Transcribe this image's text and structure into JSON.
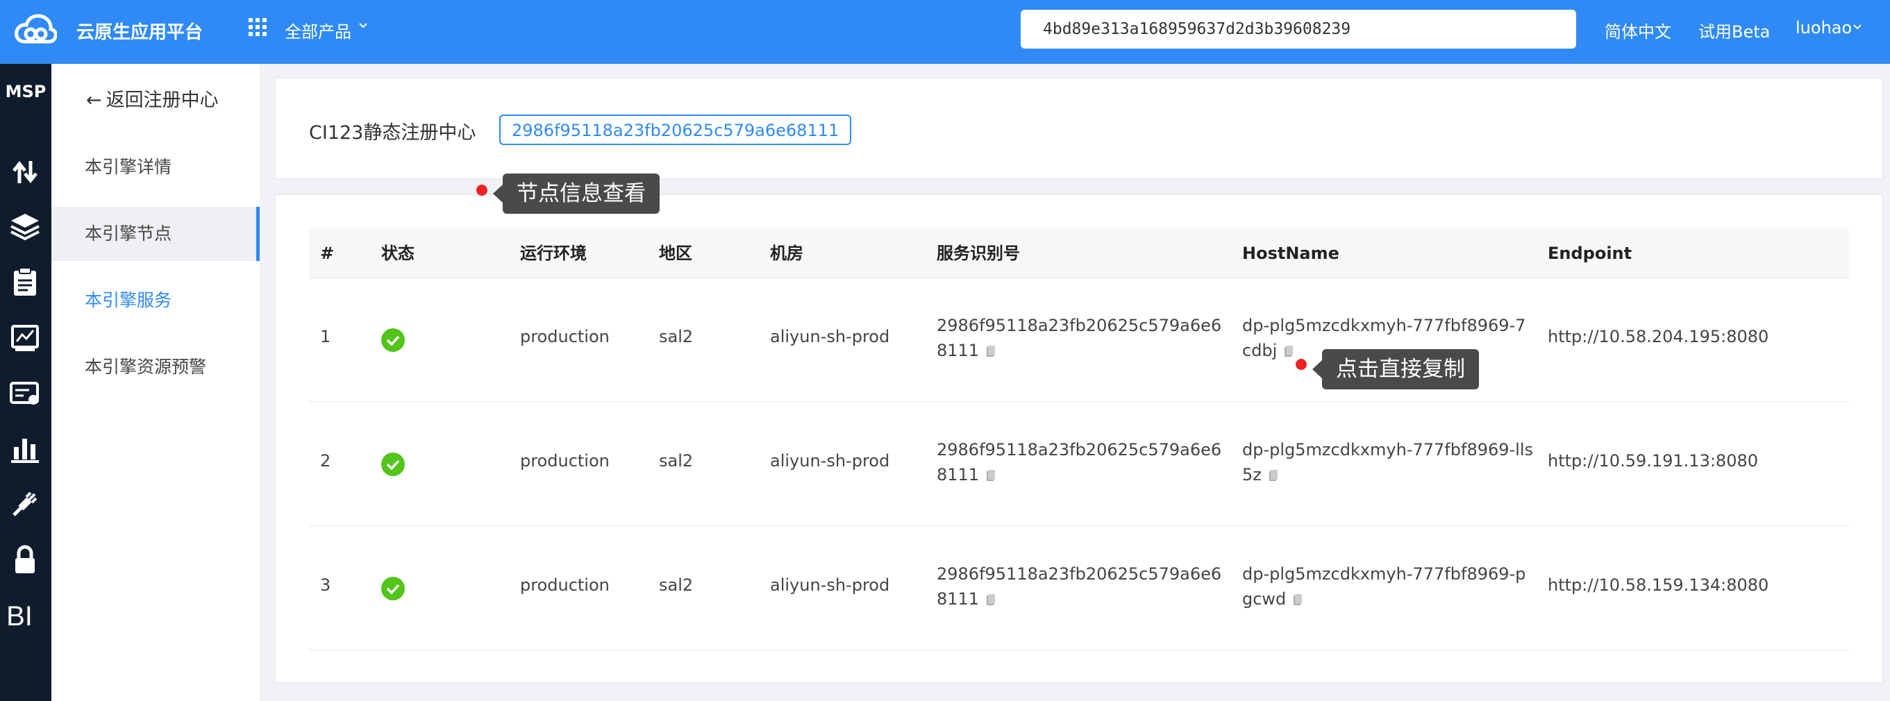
{
  "topbar": {
    "brand": "云原生应用平台",
    "all_products": "全部产品",
    "search_value": "4bd89e313a168959637d2d3b39608239",
    "language": "简体中文",
    "trial": "试用Beta",
    "user": "luohao"
  },
  "rail": {
    "msp": "MSP",
    "bi": "BI",
    "icons": [
      "arrows-updown-icon",
      "layers-icon",
      "clipboard-icon",
      "monitor-chart-icon",
      "id-card-icon",
      "bar-chart-icon",
      "plug-icon",
      "lock-icon"
    ]
  },
  "sidebar": {
    "back": "返回注册中心",
    "items": [
      {
        "label": "本引擎详情"
      },
      {
        "label": "本引擎节点"
      },
      {
        "label": "本引擎服务"
      },
      {
        "label": "本引擎资源预警"
      }
    ]
  },
  "registry": {
    "title": "CI123静态注册中心",
    "id": "2986f95118a23fb20625c579a6e68111"
  },
  "table": {
    "headers": [
      "#",
      "状态",
      "运行环境",
      "地区",
      "机房",
      "服务识别号",
      "HostName",
      "Endpoint"
    ],
    "rows": [
      {
        "index": "1",
        "status": "ok",
        "env": "production",
        "region": "sal2",
        "room": "aliyun-sh-prod",
        "service_id": "2986f95118a23fb20625c579a6e68111",
        "hostname": "dp-plg5mzcdkxmyh-777fbf8969-7cdbj",
        "endpoint": "http://10.58.204.195:8080"
      },
      {
        "index": "2",
        "status": "ok",
        "env": "production",
        "region": "sal2",
        "room": "aliyun-sh-prod",
        "service_id": "2986f95118a23fb20625c579a6e68111",
        "hostname": "dp-plg5mzcdkxmyh-777fbf8969-lls5z",
        "endpoint": "http://10.59.191.13:8080"
      },
      {
        "index": "3",
        "status": "ok",
        "env": "production",
        "region": "sal2",
        "room": "aliyun-sh-prod",
        "service_id": "2986f95118a23fb20625c579a6e68111",
        "hostname": "dp-plg5mzcdkxmyh-777fbf8969-pgcwd",
        "endpoint": "http://10.58.159.134:8080"
      }
    ]
  },
  "tooltips": {
    "node_info": "节点信息查看",
    "copy_direct": "点击直接复制"
  },
  "colors": {
    "primary": "#2f8af5",
    "rail": "#0f1c2e",
    "success": "#52c41a",
    "annotation_dot": "#ee2222"
  }
}
